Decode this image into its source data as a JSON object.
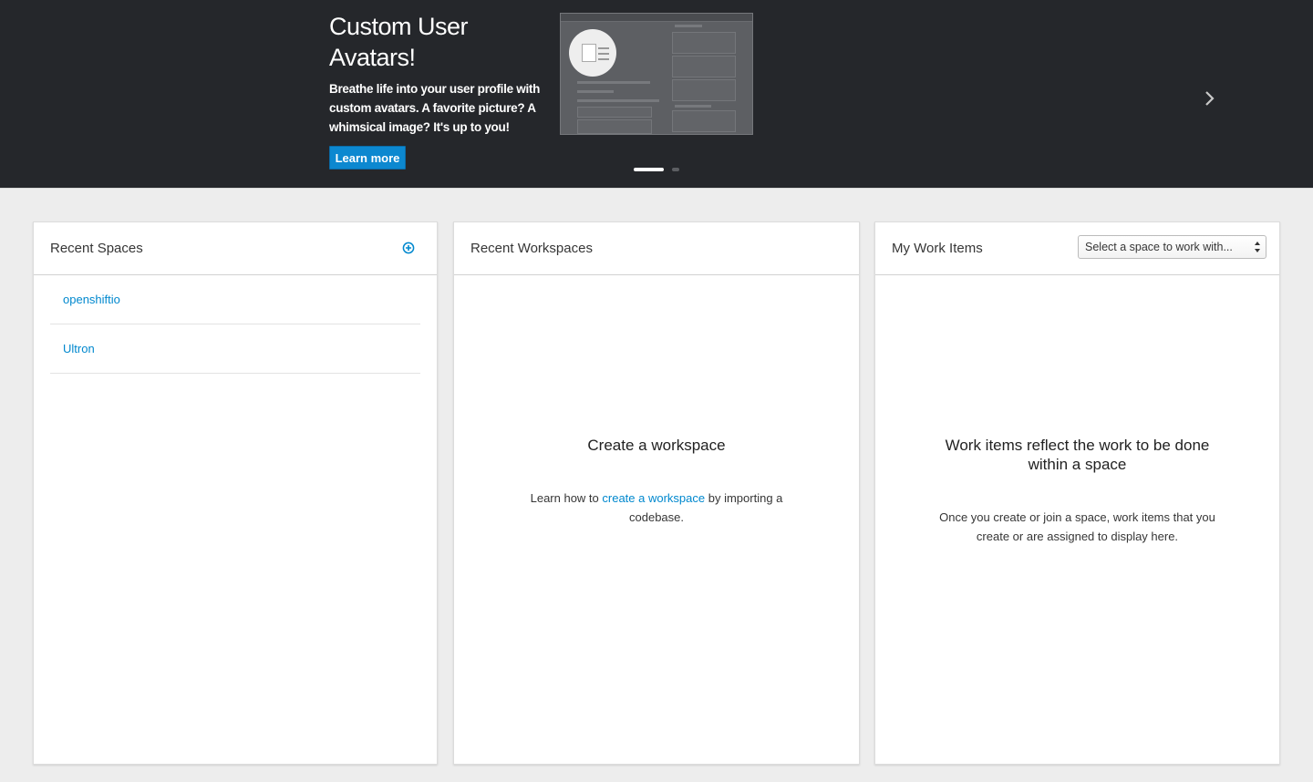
{
  "hero": {
    "title": "Custom User Avatars!",
    "text": "Breathe life into your user profile with custom avatars. A favorite picture? A whimsical image? It's up to you!",
    "cta_label": "Learn more",
    "next_icon": "chevron-right-icon",
    "slides_total": 2,
    "slide_active": 1
  },
  "recent_spaces": {
    "title": "Recent Spaces",
    "add_icon": "plus-circle-icon",
    "items": [
      {
        "label": "openshiftio"
      },
      {
        "label": "Ultron"
      }
    ]
  },
  "recent_workspaces": {
    "title": "Recent Workspaces",
    "empty_title": "Create a workspace",
    "empty_text_before": "Learn how to ",
    "empty_link": "create a workspace",
    "empty_text_after": " by importing a codebase."
  },
  "work_items": {
    "title": "My Work Items",
    "select_value": "Select a space to work with...",
    "empty_title": "Work items reflect the work to be done within a space",
    "empty_text": "Once you create or join a space, work items that you create or are assigned to display here."
  },
  "colors": {
    "hero_bg": "#25272b",
    "accent": "#0088ce",
    "button": "#0c88d0",
    "page_bg": "#ededed"
  }
}
